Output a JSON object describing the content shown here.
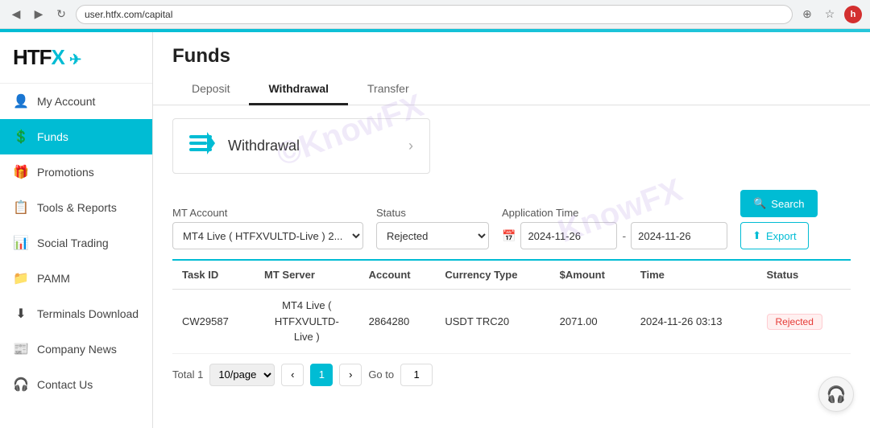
{
  "browser": {
    "url": "user.htfx.com/capital",
    "back_icon": "◀",
    "forward_icon": "▶",
    "refresh_icon": "↻",
    "avatar_label": "h"
  },
  "logo": {
    "text_black": "HTF",
    "text_cyan": "X"
  },
  "sidebar": {
    "items": [
      {
        "id": "my-account",
        "label": "My Account",
        "icon": "👤"
      },
      {
        "id": "funds",
        "label": "Funds",
        "icon": "💲",
        "active": true
      },
      {
        "id": "promotions",
        "label": "Promotions",
        "icon": "🎁"
      },
      {
        "id": "tools-reports",
        "label": "Tools & Reports",
        "icon": "📋"
      },
      {
        "id": "social-trading",
        "label": "Social Trading",
        "icon": "📊"
      },
      {
        "id": "pamm",
        "label": "PAMM",
        "icon": "📁"
      },
      {
        "id": "terminals-download",
        "label": "Terminals Download",
        "icon": "⬇"
      },
      {
        "id": "company-news",
        "label": "Company News",
        "icon": "📰"
      },
      {
        "id": "contact-us",
        "label": "Contact Us",
        "icon": "🎧"
      }
    ]
  },
  "page": {
    "title": "Funds"
  },
  "tabs": [
    {
      "id": "deposit",
      "label": "Deposit"
    },
    {
      "id": "withdrawal",
      "label": "Withdrawal",
      "active": true
    },
    {
      "id": "transfer",
      "label": "Transfer"
    }
  ],
  "withdrawal_card": {
    "label": "Withdrawal",
    "arrow": "›"
  },
  "filters": {
    "mt_account_label": "MT Account",
    "mt_account_value": "MT4 Live ( HTFXVULTD-Live ) 2...",
    "status_label": "Status",
    "status_value": "Rejected",
    "app_time_label": "Application Time",
    "date_from": "2024-11-26",
    "date_separator": "-",
    "date_to": "2024-11-26",
    "search_label": "Search",
    "export_label": "Export"
  },
  "table": {
    "headers": [
      "Task ID",
      "MT Server",
      "Account",
      "Currency Type",
      "$Amount",
      "Time",
      "Status"
    ],
    "rows": [
      {
        "task_id": "CW29587",
        "mt_server": "MT4 Live (\nHTFXVULTD-\nLive )",
        "account": "2864280",
        "currency_type": "USDT TRC20",
        "amount": "2071.00",
        "time": "2024-11-26 03:13",
        "status": "Rejected",
        "status_type": "rejected"
      }
    ]
  },
  "pagination": {
    "total_label": "Total 1",
    "per_page_label": "10/page",
    "prev_icon": "‹",
    "next_icon": "›",
    "current_page": "1",
    "goto_label": "Go to",
    "goto_value": "1"
  },
  "watermark": {
    "text1": "©KnowFX",
    "text2": "KnowFX"
  },
  "headset_icon": "🎧"
}
